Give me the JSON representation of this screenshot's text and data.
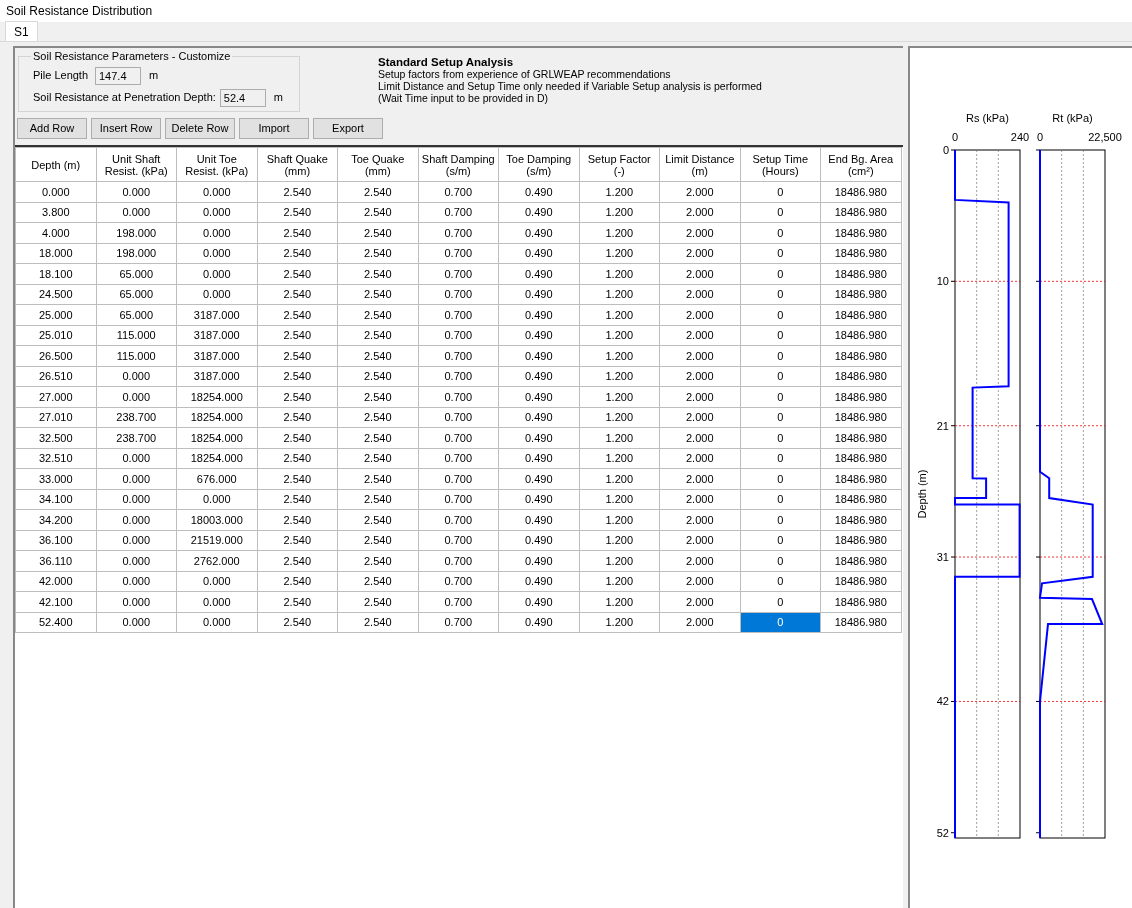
{
  "window": {
    "title": "Soil Resistance Distribution"
  },
  "tabs": [
    {
      "label": "S1",
      "selected": true
    }
  ],
  "parameters": {
    "legend": "Soil Resistance Parameters - Customize",
    "fields": [
      {
        "label": "Pile Length",
        "value": "147.4",
        "unit": "m"
      },
      {
        "label": "Soil Resistance at Penetration Depth:",
        "value": "52.4",
        "unit": "m"
      }
    ]
  },
  "setup_info": {
    "title": "Standard Setup Analysis",
    "lines": [
      "Setup factors from experience of GRLWEAP recommendations",
      "Limit Distance and Setup Time only needed if Variable Setup analysis is performed",
      "(Wait Time input to be provided in  D)"
    ]
  },
  "buttons": [
    "Add Row",
    "Insert Row",
    "Delete Row",
    "Import",
    "Export"
  ],
  "table": {
    "columns": [
      "Depth (m)",
      "Unit Shaft Resist. (kPa)",
      "Unit Toe Resist. (kPa)",
      "Shaft Quake (mm)",
      "Toe Quake (mm)",
      "Shaft Damping (s/m)",
      "Toe Damping (s/m)",
      "Setup Factor (-)",
      "Limit Distance (m)",
      "Setup Time (Hours)",
      "End Bg. Area (cm²)"
    ],
    "rows": [
      [
        {
          "text": "0.000",
          "selected": false
        },
        {
          "text": "0.000",
          "selected": false
        },
        {
          "text": "0.000",
          "selected": false
        },
        {
          "text": "2.540",
          "selected": false
        },
        {
          "text": "2.540",
          "selected": false
        },
        {
          "text": "0.700",
          "selected": false
        },
        {
          "text": "0.490",
          "selected": false
        },
        {
          "text": "1.200",
          "selected": false
        },
        {
          "text": "2.000",
          "selected": false
        },
        {
          "text": "0",
          "selected": false
        },
        {
          "text": "18486.980",
          "selected": false
        }
      ],
      [
        {
          "text": "3.800",
          "selected": false
        },
        {
          "text": "0.000",
          "selected": false
        },
        {
          "text": "0.000",
          "selected": false
        },
        {
          "text": "2.540",
          "selected": false
        },
        {
          "text": "2.540",
          "selected": false
        },
        {
          "text": "0.700",
          "selected": false
        },
        {
          "text": "0.490",
          "selected": false
        },
        {
          "text": "1.200",
          "selected": false
        },
        {
          "text": "2.000",
          "selected": false
        },
        {
          "text": "0",
          "selected": false
        },
        {
          "text": "18486.980",
          "selected": false
        }
      ],
      [
        {
          "text": "4.000",
          "selected": false
        },
        {
          "text": "198.000",
          "selected": false
        },
        {
          "text": "0.000",
          "selected": false
        },
        {
          "text": "2.540",
          "selected": false
        },
        {
          "text": "2.540",
          "selected": false
        },
        {
          "text": "0.700",
          "selected": false
        },
        {
          "text": "0.490",
          "selected": false
        },
        {
          "text": "1.200",
          "selected": false
        },
        {
          "text": "2.000",
          "selected": false
        },
        {
          "text": "0",
          "selected": false
        },
        {
          "text": "18486.980",
          "selected": false
        }
      ],
      [
        {
          "text": "18.000",
          "selected": false
        },
        {
          "text": "198.000",
          "selected": false
        },
        {
          "text": "0.000",
          "selected": false
        },
        {
          "text": "2.540",
          "selected": false
        },
        {
          "text": "2.540",
          "selected": false
        },
        {
          "text": "0.700",
          "selected": false
        },
        {
          "text": "0.490",
          "selected": false
        },
        {
          "text": "1.200",
          "selected": false
        },
        {
          "text": "2.000",
          "selected": false
        },
        {
          "text": "0",
          "selected": false
        },
        {
          "text": "18486.980",
          "selected": false
        }
      ],
      [
        {
          "text": "18.100",
          "selected": false
        },
        {
          "text": "65.000",
          "selected": false
        },
        {
          "text": "0.000",
          "selected": false
        },
        {
          "text": "2.540",
          "selected": false
        },
        {
          "text": "2.540",
          "selected": false
        },
        {
          "text": "0.700",
          "selected": false
        },
        {
          "text": "0.490",
          "selected": false
        },
        {
          "text": "1.200",
          "selected": false
        },
        {
          "text": "2.000",
          "selected": false
        },
        {
          "text": "0",
          "selected": false
        },
        {
          "text": "18486.980",
          "selected": false
        }
      ],
      [
        {
          "text": "24.500",
          "selected": false
        },
        {
          "text": "65.000",
          "selected": false
        },
        {
          "text": "0.000",
          "selected": false
        },
        {
          "text": "2.540",
          "selected": false
        },
        {
          "text": "2.540",
          "selected": false
        },
        {
          "text": "0.700",
          "selected": false
        },
        {
          "text": "0.490",
          "selected": false
        },
        {
          "text": "1.200",
          "selected": false
        },
        {
          "text": "2.000",
          "selected": false
        },
        {
          "text": "0",
          "selected": false
        },
        {
          "text": "18486.980",
          "selected": false
        }
      ],
      [
        {
          "text": "25.000",
          "selected": false
        },
        {
          "text": "65.000",
          "selected": false
        },
        {
          "text": "3187.000",
          "selected": false
        },
        {
          "text": "2.540",
          "selected": false
        },
        {
          "text": "2.540",
          "selected": false
        },
        {
          "text": "0.700",
          "selected": false
        },
        {
          "text": "0.490",
          "selected": false
        },
        {
          "text": "1.200",
          "selected": false
        },
        {
          "text": "2.000",
          "selected": false
        },
        {
          "text": "0",
          "selected": false
        },
        {
          "text": "18486.980",
          "selected": false
        }
      ],
      [
        {
          "text": "25.010",
          "selected": false
        },
        {
          "text": "115.000",
          "selected": false
        },
        {
          "text": "3187.000",
          "selected": false
        },
        {
          "text": "2.540",
          "selected": false
        },
        {
          "text": "2.540",
          "selected": false
        },
        {
          "text": "0.700",
          "selected": false
        },
        {
          "text": "0.490",
          "selected": false
        },
        {
          "text": "1.200",
          "selected": false
        },
        {
          "text": "2.000",
          "selected": false
        },
        {
          "text": "0",
          "selected": false
        },
        {
          "text": "18486.980",
          "selected": false
        }
      ],
      [
        {
          "text": "26.500",
          "selected": false
        },
        {
          "text": "115.000",
          "selected": false
        },
        {
          "text": "3187.000",
          "selected": false
        },
        {
          "text": "2.540",
          "selected": false
        },
        {
          "text": "2.540",
          "selected": false
        },
        {
          "text": "0.700",
          "selected": false
        },
        {
          "text": "0.490",
          "selected": false
        },
        {
          "text": "1.200",
          "selected": false
        },
        {
          "text": "2.000",
          "selected": false
        },
        {
          "text": "0",
          "selected": false
        },
        {
          "text": "18486.980",
          "selected": false
        }
      ],
      [
        {
          "text": "26.510",
          "selected": false
        },
        {
          "text": "0.000",
          "selected": false
        },
        {
          "text": "3187.000",
          "selected": false
        },
        {
          "text": "2.540",
          "selected": false
        },
        {
          "text": "2.540",
          "selected": false
        },
        {
          "text": "0.700",
          "selected": false
        },
        {
          "text": "0.490",
          "selected": false
        },
        {
          "text": "1.200",
          "selected": false
        },
        {
          "text": "2.000",
          "selected": false
        },
        {
          "text": "0",
          "selected": false
        },
        {
          "text": "18486.980",
          "selected": false
        }
      ],
      [
        {
          "text": "27.000",
          "selected": false
        },
        {
          "text": "0.000",
          "selected": false
        },
        {
          "text": "18254.000",
          "selected": false
        },
        {
          "text": "2.540",
          "selected": false
        },
        {
          "text": "2.540",
          "selected": false
        },
        {
          "text": "0.700",
          "selected": false
        },
        {
          "text": "0.490",
          "selected": false
        },
        {
          "text": "1.200",
          "selected": false
        },
        {
          "text": "2.000",
          "selected": false
        },
        {
          "text": "0",
          "selected": false
        },
        {
          "text": "18486.980",
          "selected": false
        }
      ],
      [
        {
          "text": "27.010",
          "selected": false
        },
        {
          "text": "238.700",
          "selected": false
        },
        {
          "text": "18254.000",
          "selected": false
        },
        {
          "text": "2.540",
          "selected": false
        },
        {
          "text": "2.540",
          "selected": false
        },
        {
          "text": "0.700",
          "selected": false
        },
        {
          "text": "0.490",
          "selected": false
        },
        {
          "text": "1.200",
          "selected": false
        },
        {
          "text": "2.000",
          "selected": false
        },
        {
          "text": "0",
          "selected": false
        },
        {
          "text": "18486.980",
          "selected": false
        }
      ],
      [
        {
          "text": "32.500",
          "selected": false
        },
        {
          "text": "238.700",
          "selected": false
        },
        {
          "text": "18254.000",
          "selected": false
        },
        {
          "text": "2.540",
          "selected": false
        },
        {
          "text": "2.540",
          "selected": false
        },
        {
          "text": "0.700",
          "selected": false
        },
        {
          "text": "0.490",
          "selected": false
        },
        {
          "text": "1.200",
          "selected": false
        },
        {
          "text": "2.000",
          "selected": false
        },
        {
          "text": "0",
          "selected": false
        },
        {
          "text": "18486.980",
          "selected": false
        }
      ],
      [
        {
          "text": "32.510",
          "selected": false
        },
        {
          "text": "0.000",
          "selected": false
        },
        {
          "text": "18254.000",
          "selected": false
        },
        {
          "text": "2.540",
          "selected": false
        },
        {
          "text": "2.540",
          "selected": false
        },
        {
          "text": "0.700",
          "selected": false
        },
        {
          "text": "0.490",
          "selected": false
        },
        {
          "text": "1.200",
          "selected": false
        },
        {
          "text": "2.000",
          "selected": false
        },
        {
          "text": "0",
          "selected": false
        },
        {
          "text": "18486.980",
          "selected": false
        }
      ],
      [
        {
          "text": "33.000",
          "selected": false
        },
        {
          "text": "0.000",
          "selected": false
        },
        {
          "text": "676.000",
          "selected": false
        },
        {
          "text": "2.540",
          "selected": false
        },
        {
          "text": "2.540",
          "selected": false
        },
        {
          "text": "0.700",
          "selected": false
        },
        {
          "text": "0.490",
          "selected": false
        },
        {
          "text": "1.200",
          "selected": false
        },
        {
          "text": "2.000",
          "selected": false
        },
        {
          "text": "0",
          "selected": false
        },
        {
          "text": "18486.980",
          "selected": false
        }
      ],
      [
        {
          "text": "34.100",
          "selected": false
        },
        {
          "text": "0.000",
          "selected": false
        },
        {
          "text": "0.000",
          "selected": false
        },
        {
          "text": "2.540",
          "selected": false
        },
        {
          "text": "2.540",
          "selected": false
        },
        {
          "text": "0.700",
          "selected": false
        },
        {
          "text": "0.490",
          "selected": false
        },
        {
          "text": "1.200",
          "selected": false
        },
        {
          "text": "2.000",
          "selected": false
        },
        {
          "text": "0",
          "selected": false
        },
        {
          "text": "18486.980",
          "selected": false
        }
      ],
      [
        {
          "text": "34.200",
          "selected": false
        },
        {
          "text": "0.000",
          "selected": false
        },
        {
          "text": "18003.000",
          "selected": false
        },
        {
          "text": "2.540",
          "selected": false
        },
        {
          "text": "2.540",
          "selected": false
        },
        {
          "text": "0.700",
          "selected": false
        },
        {
          "text": "0.490",
          "selected": false
        },
        {
          "text": "1.200",
          "selected": false
        },
        {
          "text": "2.000",
          "selected": false
        },
        {
          "text": "0",
          "selected": false
        },
        {
          "text": "18486.980",
          "selected": false
        }
      ],
      [
        {
          "text": "36.100",
          "selected": false
        },
        {
          "text": "0.000",
          "selected": false
        },
        {
          "text": "21519.000",
          "selected": false
        },
        {
          "text": "2.540",
          "selected": false
        },
        {
          "text": "2.540",
          "selected": false
        },
        {
          "text": "0.700",
          "selected": false
        },
        {
          "text": "0.490",
          "selected": false
        },
        {
          "text": "1.200",
          "selected": false
        },
        {
          "text": "2.000",
          "selected": false
        },
        {
          "text": "0",
          "selected": false
        },
        {
          "text": "18486.980",
          "selected": false
        }
      ],
      [
        {
          "text": "36.110",
          "selected": false
        },
        {
          "text": "0.000",
          "selected": false
        },
        {
          "text": "2762.000",
          "selected": false
        },
        {
          "text": "2.540",
          "selected": false
        },
        {
          "text": "2.540",
          "selected": false
        },
        {
          "text": "0.700",
          "selected": false
        },
        {
          "text": "0.490",
          "selected": false
        },
        {
          "text": "1.200",
          "selected": false
        },
        {
          "text": "2.000",
          "selected": false
        },
        {
          "text": "0",
          "selected": false
        },
        {
          "text": "18486.980",
          "selected": false
        }
      ],
      [
        {
          "text": "42.000",
          "selected": false
        },
        {
          "text": "0.000",
          "selected": false
        },
        {
          "text": "0.000",
          "selected": false
        },
        {
          "text": "2.540",
          "selected": false
        },
        {
          "text": "2.540",
          "selected": false
        },
        {
          "text": "0.700",
          "selected": false
        },
        {
          "text": "0.490",
          "selected": false
        },
        {
          "text": "1.200",
          "selected": false
        },
        {
          "text": "2.000",
          "selected": false
        },
        {
          "text": "0",
          "selected": false
        },
        {
          "text": "18486.980",
          "selected": false
        }
      ],
      [
        {
          "text": "42.100",
          "selected": false
        },
        {
          "text": "0.000",
          "selected": false
        },
        {
          "text": "0.000",
          "selected": false
        },
        {
          "text": "2.540",
          "selected": false
        },
        {
          "text": "2.540",
          "selected": false
        },
        {
          "text": "0.700",
          "selected": false
        },
        {
          "text": "0.490",
          "selected": false
        },
        {
          "text": "1.200",
          "selected": false
        },
        {
          "text": "2.000",
          "selected": false
        },
        {
          "text": "0",
          "selected": false
        },
        {
          "text": "18486.980",
          "selected": false
        }
      ],
      [
        {
          "text": "52.400",
          "selected": false
        },
        {
          "text": "0.000",
          "selected": false
        },
        {
          "text": "0.000",
          "selected": false
        },
        {
          "text": "2.540",
          "selected": false
        },
        {
          "text": "2.540",
          "selected": false
        },
        {
          "text": "0.700",
          "selected": false
        },
        {
          "text": "0.490",
          "selected": false
        },
        {
          "text": "1.200",
          "selected": false
        },
        {
          "text": "2.000",
          "selected": false
        },
        {
          "text": "0",
          "selected": true
        },
        {
          "text": "18486.980",
          "selected": false
        }
      ]
    ]
  },
  "charts": [
    {
      "chart_data": {
        "type": "line",
        "ylabel": "Depth (m)",
        "x": [
          0,
          0,
          198,
          198,
          65,
          65,
          65,
          115,
          115,
          0,
          0,
          238.7,
          238.7,
          0,
          0,
          0,
          0,
          0,
          0,
          0,
          0,
          0
        ],
        "series": [
          {
            "name": "Rs (kPa)",
            "color": "#0000ff",
            "values": [
              0,
              3.8,
              4,
              18,
              18.1,
              24.5,
              25,
              25.01,
              26.5,
              26.51,
              27,
              27.01,
              32.5,
              32.51,
              33,
              34.1,
              34.2,
              36.1,
              36.11,
              42,
              42.1,
              52.4
            ]
          }
        ],
        "xlim": [
          0,
          240
        ],
        "ylim": [
          52.4,
          0
        ],
        "grid": true,
        "ref_lines": [
          {
            "axis": "x",
            "value": 80
          },
          {
            "axis": "x",
            "value": 160
          }
        ],
        "xticks": [
          0,
          240
        ],
        "yticks": [
          0,
          10,
          21,
          31,
          42,
          52
        ]
      }
    },
    {
      "chart_data": {
        "type": "line",
        "x": [
          0,
          0,
          0,
          0,
          0,
          0,
          3187,
          3187,
          3187,
          3187,
          18254,
          18254,
          18254,
          18254,
          676,
          0,
          18003,
          21519,
          2762,
          0,
          0,
          0
        ],
        "series": [
          {
            "name": "Rt (kPa)",
            "color": "#0000ff",
            "values": [
              0,
              3.8,
              4,
              18,
              18.1,
              24.5,
              25,
              25.01,
              26.5,
              26.51,
              27,
              27.01,
              32.5,
              32.51,
              33,
              34.1,
              34.2,
              36.1,
              36.11,
              42,
              42.1,
              52.4
            ]
          }
        ],
        "xlim": [
          0,
          22500
        ],
        "ylim": [
          52.4,
          0
        ],
        "grid": true,
        "ref_lines": [
          {
            "axis": "x",
            "value": 7500
          },
          {
            "axis": "x",
            "value": 15000
          }
        ],
        "xticks": [
          {
            "value": 0,
            "label": "0"
          },
          {
            "value": 22500,
            "label": "22,500"
          }
        ]
      }
    }
  ]
}
